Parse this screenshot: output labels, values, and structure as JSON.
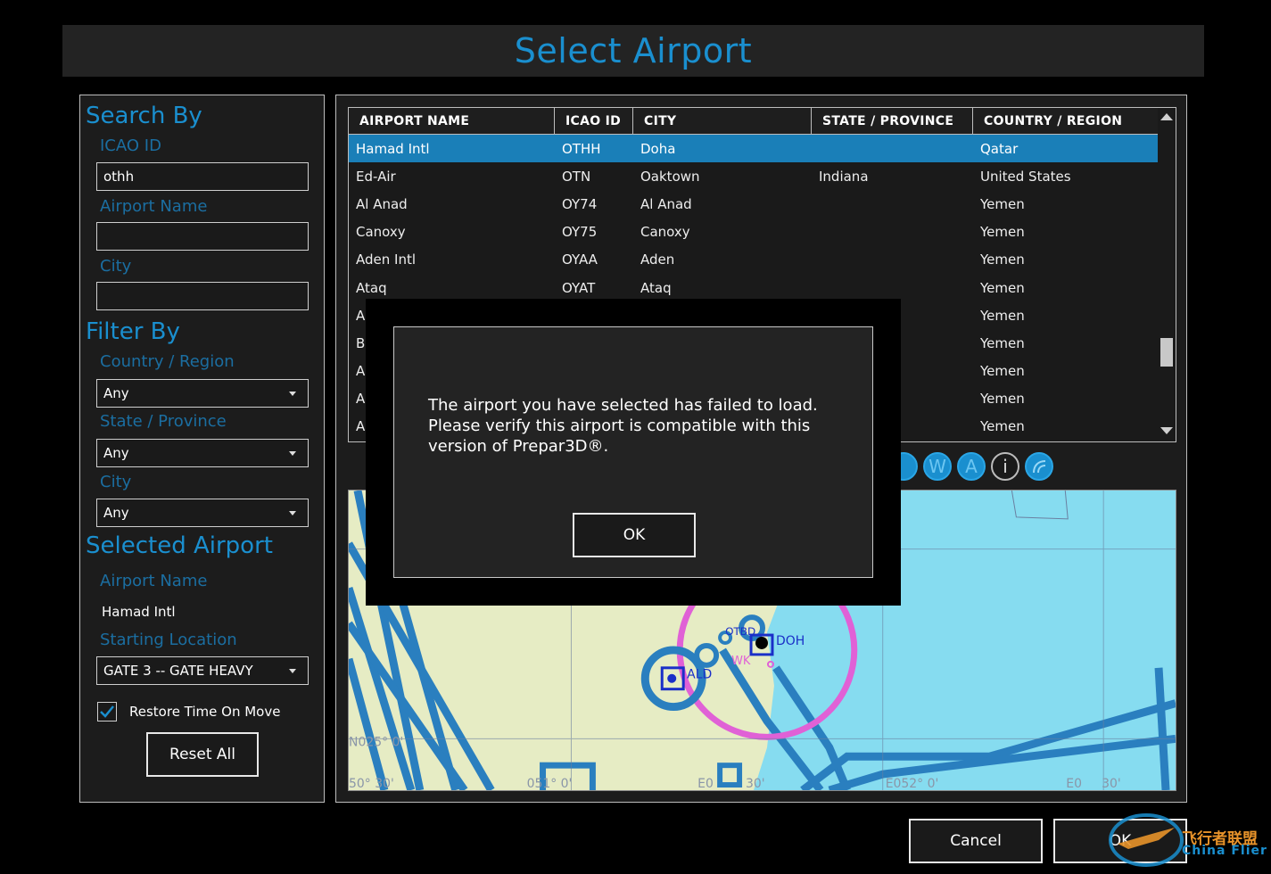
{
  "window": {
    "title": "Select Airport"
  },
  "search": {
    "heading": "Search By",
    "icao_label": "ICAO ID",
    "icao_value": "othh",
    "name_label": "Airport Name",
    "name_value": "",
    "city_label": "City",
    "city_value": ""
  },
  "filter": {
    "heading": "Filter By",
    "country_label": "Country / Region",
    "country_value": "Any",
    "state_label": "State / Province",
    "state_value": "Any",
    "city_label": "City",
    "city_value": "Any"
  },
  "selected": {
    "heading": "Selected Airport",
    "name_label": "Airport Name",
    "name_value": "Hamad Intl",
    "start_label": "Starting Location",
    "start_value": "GATE 3 -- GATE HEAVY",
    "restore_label": "Restore Time On Move",
    "restore_checked": true,
    "reset_label": "Reset All"
  },
  "table": {
    "headers": [
      "AIRPORT NAME",
      "ICAO ID",
      "CITY",
      "STATE / PROVINCE",
      "COUNTRY / REGION"
    ],
    "rows": [
      [
        "Hamad Intl",
        "OTHH",
        "Doha",
        "",
        "Qatar"
      ],
      [
        "Ed-Air",
        "OTN",
        "Oaktown",
        "Indiana",
        "United States"
      ],
      [
        "Al Anad",
        "OY74",
        "Al Anad",
        "",
        "Yemen"
      ],
      [
        "Canoxy",
        "OY75",
        "Canoxy",
        "",
        "Yemen"
      ],
      [
        "Aden Intl",
        "OYAA",
        "Aden",
        "",
        "Yemen"
      ],
      [
        "Ataq",
        "OYAT",
        "Ataq",
        "",
        "Yemen"
      ],
      [
        "A",
        "",
        "",
        "",
        "Yemen"
      ],
      [
        "B",
        "",
        "",
        "",
        "Yemen"
      ],
      [
        "A",
        "",
        "",
        "",
        "Yemen"
      ],
      [
        "A",
        "",
        "",
        "",
        "Yemen"
      ],
      [
        "A",
        "",
        "",
        "",
        "Yemen"
      ]
    ]
  },
  "map_tools": [
    "W",
    "A",
    "i"
  ],
  "map_labels": {
    "doh": "DOH",
    "ald": "ALD",
    "otbd": "OTBD",
    "wk": "WK",
    "lat1": "N025° 0'",
    "lon1": "E052° 0'",
    "lon0": "E0",
    "lon30": "30'",
    "lon2": "051° 0'",
    "lat0": "50° 30'",
    "lonR": "E0",
    "lonR30": "30'"
  },
  "buttons": {
    "cancel": "Cancel",
    "ok": "OK"
  },
  "modal": {
    "message": "The airport you have selected has failed to load. Please verify this airport is compatible with this version of Prepar3D®.",
    "ok": "OK"
  },
  "watermark": {
    "cn": "飞行者联盟",
    "en": "China Flier"
  },
  "colors": {
    "accent": "#1a8fcf",
    "selection": "#1a7fb8",
    "map_water": "#86dcf0",
    "map_land": "#e6ecc4"
  }
}
